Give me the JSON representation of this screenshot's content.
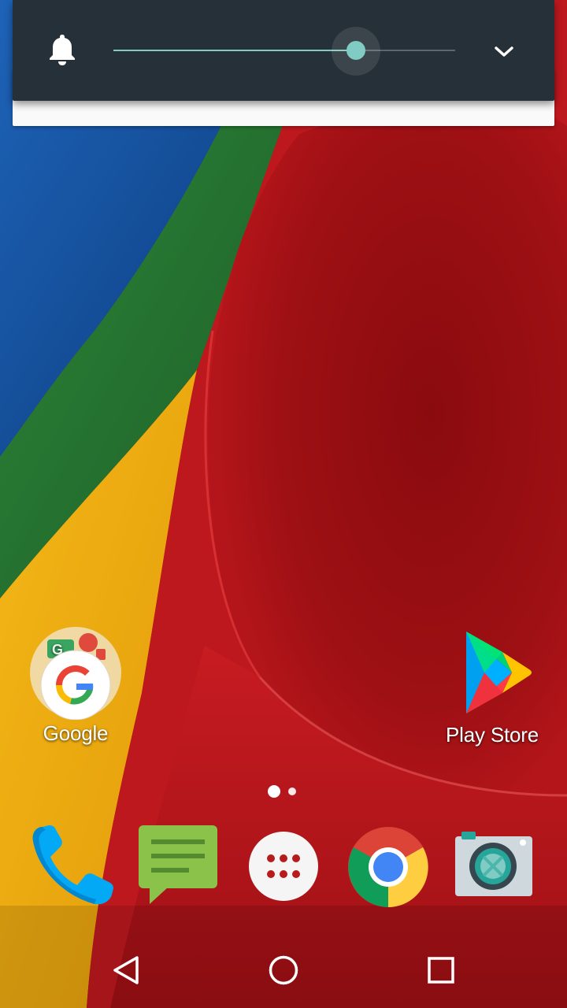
{
  "volume_panel": {
    "level_percent": 71,
    "accent_color": "#80cbc4",
    "icons": {
      "ringer": "bell-icon",
      "expand": "chevron-down-icon"
    }
  },
  "home_screen": {
    "apps": [
      {
        "label": "Google",
        "icon": "google-folder-icon"
      },
      {
        "label": "Play Store",
        "icon": "play-store-icon"
      }
    ],
    "pages": {
      "count": 2,
      "current": 1
    },
    "dock": [
      "phone-icon",
      "messages-icon",
      "app-drawer-icon",
      "chrome-icon",
      "camera-icon"
    ]
  },
  "navbar": {
    "buttons": [
      "back-icon",
      "home-icon",
      "recents-icon"
    ]
  }
}
